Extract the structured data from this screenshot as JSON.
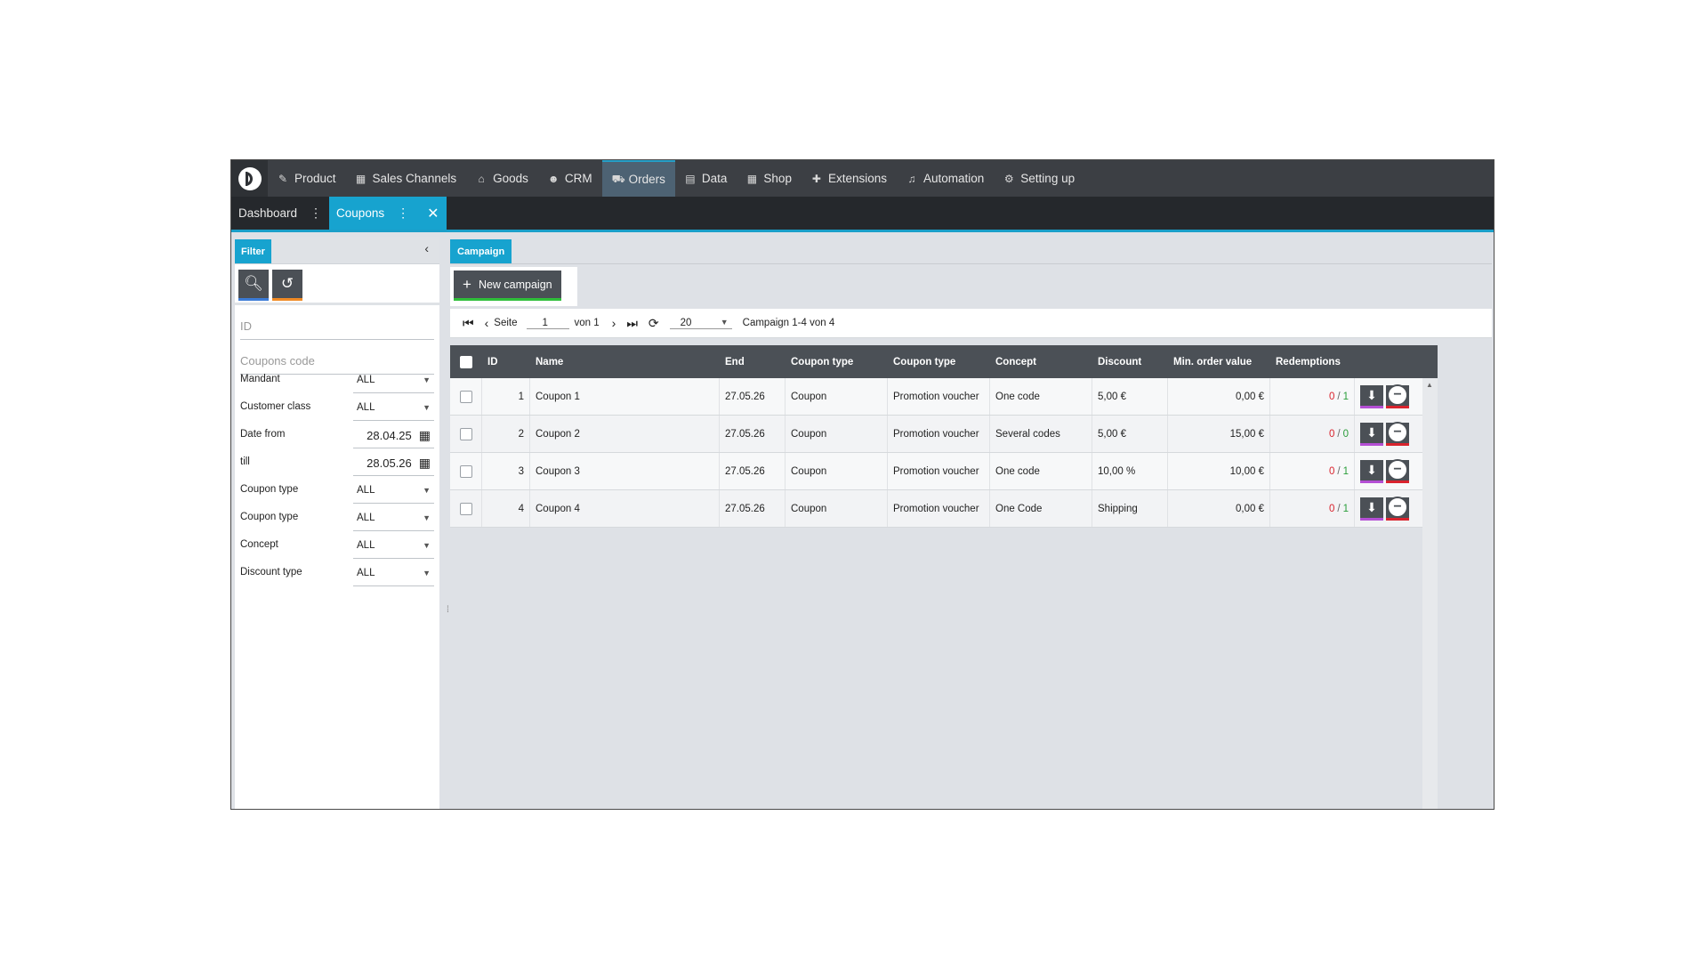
{
  "nav": {
    "items": [
      {
        "label": "Product",
        "icon": "tag-icon",
        "glyph": "✎"
      },
      {
        "label": "Sales Channels",
        "icon": "store-icon",
        "glyph": "▦"
      },
      {
        "label": "Goods",
        "icon": "boxes-icon",
        "glyph": "⌂"
      },
      {
        "label": "CRM",
        "icon": "users-icon",
        "glyph": "☻"
      },
      {
        "label": "Orders",
        "icon": "cart-icon",
        "glyph": "⛟"
      },
      {
        "label": "Data",
        "icon": "database-icon",
        "glyph": "▤"
      },
      {
        "label": "Shop",
        "icon": "shop-icon",
        "glyph": "▦"
      },
      {
        "label": "Extensions",
        "icon": "puzzle-icon",
        "glyph": "✚"
      },
      {
        "label": "Automation",
        "icon": "automation-icon",
        "glyph": "♫"
      },
      {
        "label": "Setting up",
        "icon": "gear-icon",
        "glyph": "⚙"
      }
    ],
    "active_index": 4
  },
  "tabs": {
    "dashboard": "Dashboard",
    "coupons": "Coupons"
  },
  "filter": {
    "chip": "Filter",
    "id_placeholder": "ID",
    "code_placeholder": "Coupons code",
    "rows": [
      {
        "label": "Mandant",
        "value": "ALL"
      },
      {
        "label": "Customer class",
        "value": "ALL"
      },
      {
        "label": "Date from",
        "value": "28.04.25"
      },
      {
        "label": "till",
        "value": "28.05.26"
      },
      {
        "label": "Coupon type",
        "value": "ALL"
      },
      {
        "label": "Coupon type",
        "value": "ALL"
      },
      {
        "label": "Concept",
        "value": "ALL"
      },
      {
        "label": "Discount type",
        "value": "ALL"
      }
    ]
  },
  "campaign": {
    "chip": "Campaign",
    "new_button": "New campaign",
    "pager": {
      "seite_label": "Seite",
      "page": "1",
      "von_label": "von 1",
      "per_page": "20",
      "summary": "Campaign 1-4 von 4"
    },
    "columns": [
      "ID",
      "Name",
      "End",
      "Coupon type",
      "Coupon type",
      "Concept",
      "Discount",
      "Min. order value",
      "Redemptions"
    ],
    "rows": [
      {
        "id": "1",
        "name": "Coupon 1",
        "end": "27.05.26",
        "type1": "Coupon",
        "type2": "Promotion voucher",
        "concept": "One code",
        "discount": "5,00 €",
        "min": "0,00 €",
        "red_used": "0",
        "red_total": "1"
      },
      {
        "id": "2",
        "name": "Coupon 2",
        "end": "27.05.26",
        "type1": "Coupon",
        "type2": "Promotion voucher",
        "concept": "Several codes",
        "discount": "5,00 €",
        "min": "15,00 €",
        "red_used": "0",
        "red_total": "0"
      },
      {
        "id": "3",
        "name": "Coupon 3",
        "end": "27.05.26",
        "type1": "Coupon",
        "type2": "Promotion voucher",
        "concept": "One code",
        "discount": "10,00 %",
        "min": "10,00 €",
        "red_used": "0",
        "red_total": "1"
      },
      {
        "id": "4",
        "name": "Coupon 4",
        "end": "27.05.26",
        "type1": "Coupon",
        "type2": "Promotion voucher",
        "concept": "One Code",
        "discount": "Shipping",
        "min": "0,00 €",
        "red_used": "0",
        "red_total": "1"
      }
    ]
  },
  "colors": {
    "accent": "#17a3cf",
    "nav_bg": "#3c3f44",
    "button_dark": "#4b5056",
    "redemption_used": "#d9232d",
    "redemption_total": "#2a9d3a"
  }
}
